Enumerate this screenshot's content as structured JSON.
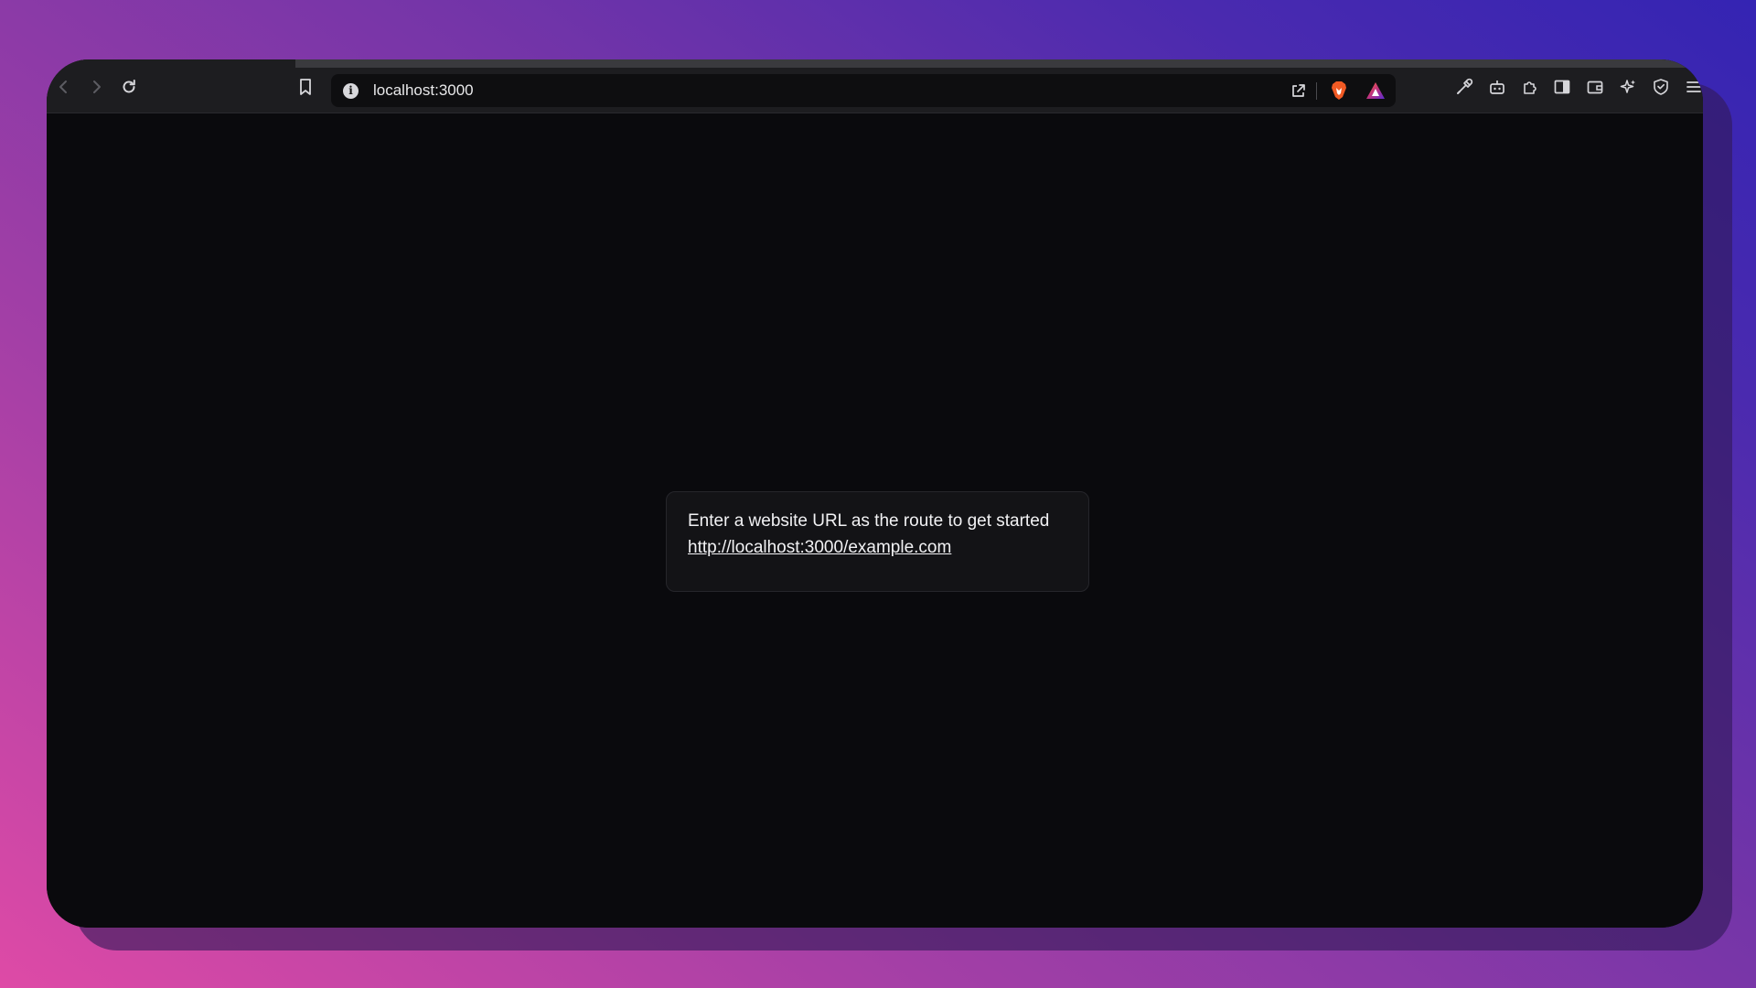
{
  "browser": {
    "address_bar": {
      "url": "localhost:3000"
    },
    "toolbar_icons": [
      "back-icon",
      "forward-icon",
      "reload-icon",
      "bookmark-icon",
      "site-info-icon",
      "share-icon",
      "brave-shields-icon",
      "brave-rewards-icon",
      "eyedropper-icon",
      "leo-ai-icon",
      "extensions-icon",
      "sidebar-icon",
      "wallet-icon",
      "ai-sparkle-icon",
      "vpn-shield-icon",
      "menu-icon"
    ]
  },
  "page": {
    "message": "Enter a website URL as the route to get started",
    "example_link": "http://localhost:3000/example.com"
  },
  "colors": {
    "background_gradient_start": "#de4aa6",
    "background_gradient_end": "#3424b3",
    "page_background": "#0a0a0d",
    "card_background": "#131316",
    "toolbar_background": "#1d1d20",
    "brave_orange": "#f15a24"
  }
}
